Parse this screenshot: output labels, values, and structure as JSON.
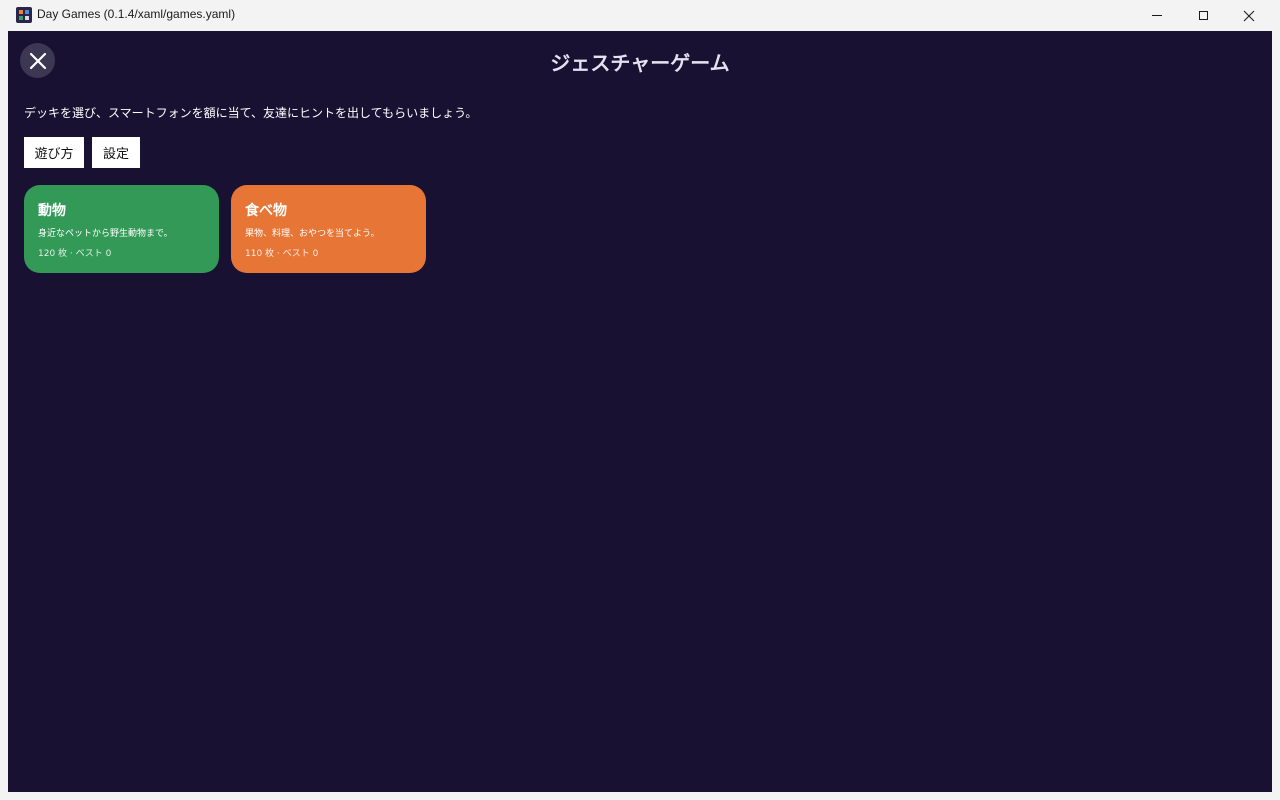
{
  "window": {
    "title": "Day Games (0.1.4/xaml/games.yaml)",
    "icon": "app-grid-icon",
    "controls": [
      "minimize-icon",
      "maximize-icon",
      "close-icon"
    ]
  },
  "header": {
    "close_icon": "close-x-icon",
    "title": "ジェスチャーゲーム"
  },
  "intro": {
    "text": "デッキを選び、スマートフォンを額に当て、友達にヒントを出してもらいましょう。"
  },
  "actions": {
    "howto_label": "遊び方",
    "settings_label": "設定"
  },
  "decks": [
    {
      "name": "動物",
      "description": "身近なペットから野生動物まで。",
      "stats": "120 枚 · ベスト 0",
      "color": "#339957"
    },
    {
      "name": "食べ物",
      "description": "果物、料理、おやつを当てよう。",
      "stats": "110 枚 · ベスト 0",
      "color": "#e77535"
    }
  ],
  "colors": {
    "background": "#181131",
    "close_button": "#3c3752",
    "title_text": "#e4e2f0"
  }
}
